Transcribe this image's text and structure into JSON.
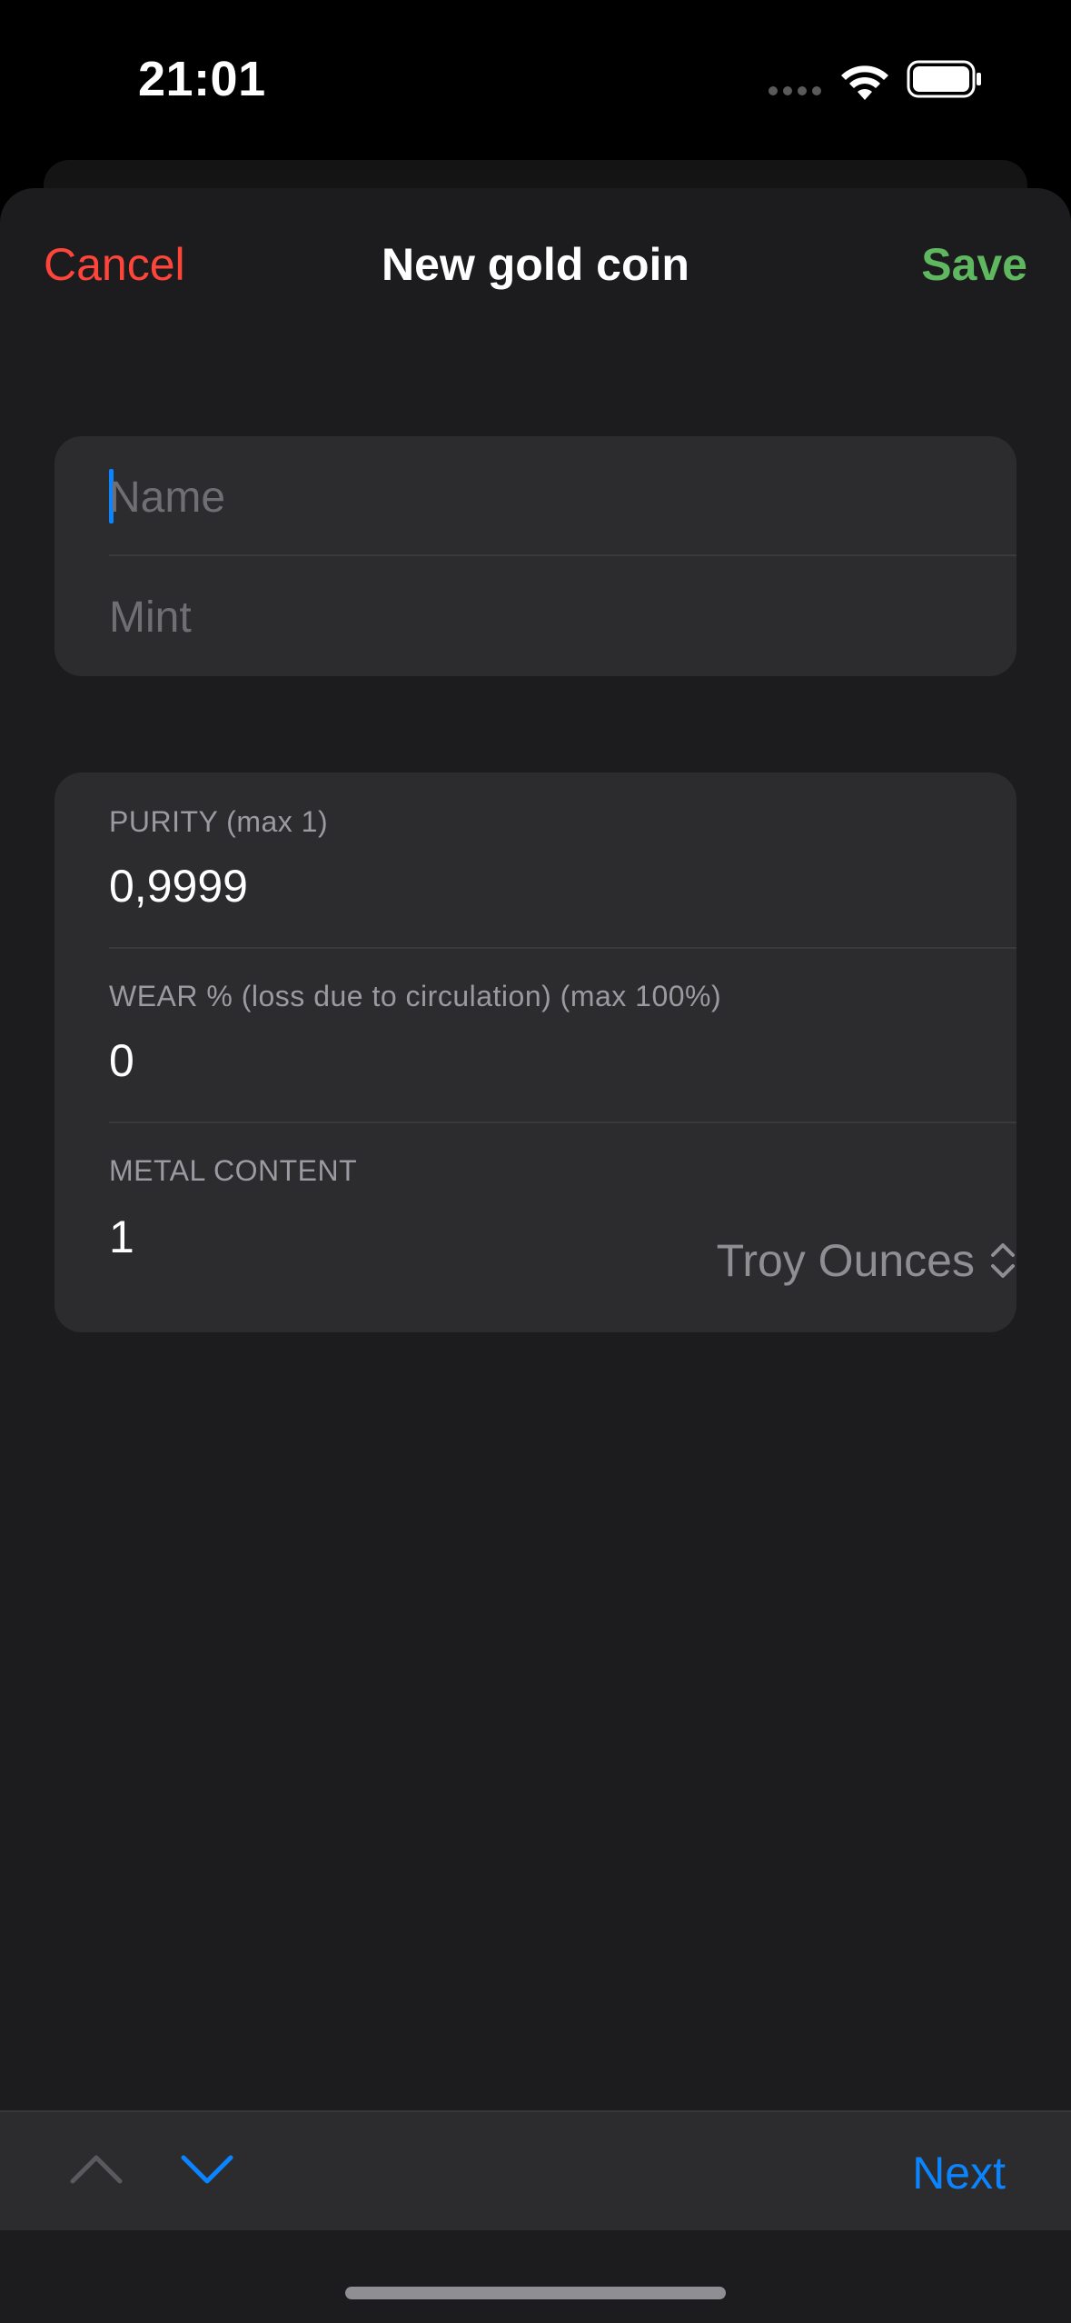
{
  "status_bar": {
    "time": "21:01"
  },
  "nav": {
    "cancel_label": "Cancel",
    "title": "New gold coin",
    "save_label": "Save"
  },
  "identity_group": {
    "name_placeholder": "Name",
    "mint_placeholder": "Mint"
  },
  "metal_group": {
    "purity_label": "PURITY (max 1)",
    "purity_value": "0,9999",
    "wear_label": "WEAR % (loss due to circulation) (max 100%)",
    "wear_value": "0",
    "metal_content_label": "METAL CONTENT",
    "metal_content_value": "1",
    "unit_selected": "Troy Ounces"
  },
  "keyboard_toolbar": {
    "next_label": "Next"
  },
  "colors": {
    "cancel": "#ff453a",
    "save": "#5fb85f",
    "accent": "#0a84ff",
    "background": "#1c1c1e",
    "group_background": "#2c2c2e"
  },
  "icons": {
    "wifi": "wifi-icon",
    "battery": "battery-icon",
    "unit_picker": "chevron-up-down-icon",
    "previous_field": "chevron-up-icon",
    "next_field": "chevron-down-icon"
  }
}
